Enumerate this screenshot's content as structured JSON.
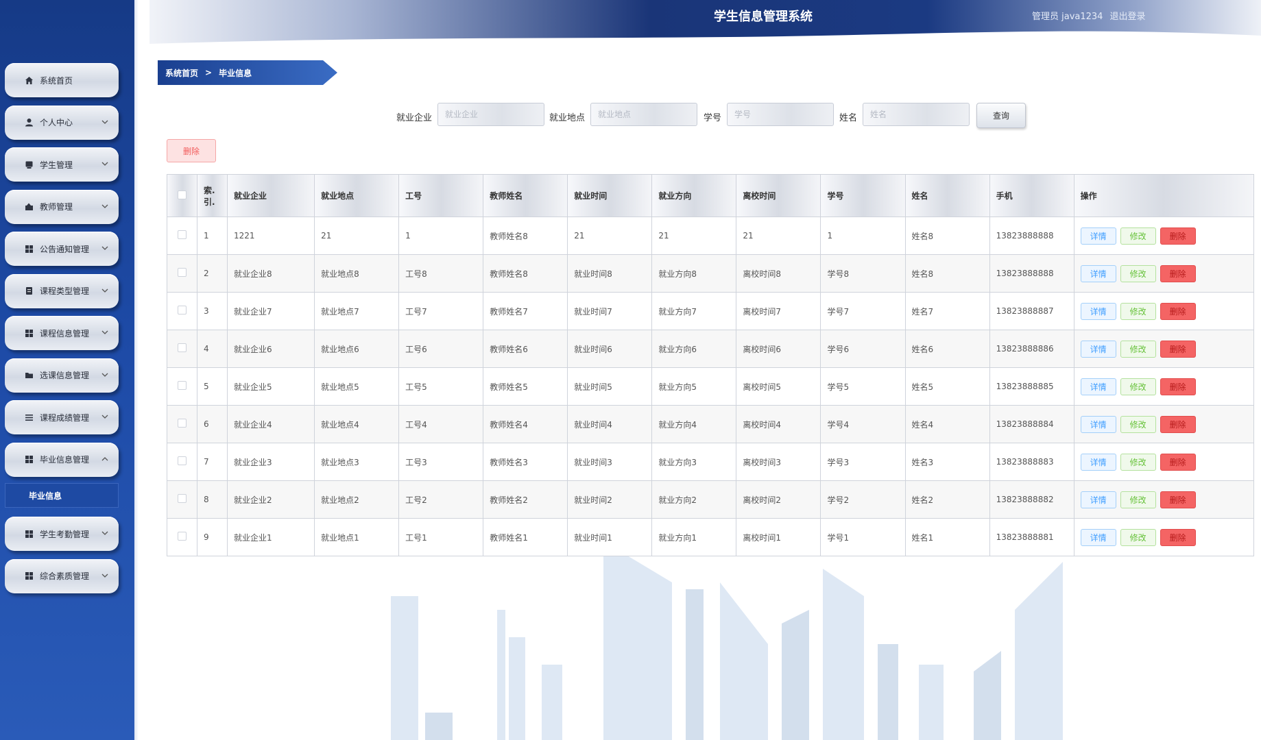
{
  "header": {
    "title": "学生信息管理系统",
    "user": "管理员 java1234",
    "logout": "退出登录"
  },
  "sidebar": {
    "items": [
      {
        "label": "系统首页",
        "icon": "home-icon"
      },
      {
        "label": "个人中心",
        "icon": "user-icon",
        "chevron": "down"
      },
      {
        "label": "学生管理",
        "icon": "card-icon",
        "chevron": "down"
      },
      {
        "label": "教师管理",
        "icon": "teacher-icon",
        "chevron": "down"
      },
      {
        "label": "公告通知管理",
        "icon": "grid-icon",
        "chevron": "down"
      },
      {
        "label": "课程类型管理",
        "icon": "doc-icon",
        "chevron": "down"
      },
      {
        "label": "课程信息管理",
        "icon": "grid-icon",
        "chevron": "down"
      },
      {
        "label": "选课信息管理",
        "icon": "folder-icon",
        "chevron": "down"
      },
      {
        "label": "课程成绩管理",
        "icon": "list-icon",
        "chevron": "down"
      },
      {
        "label": "毕业信息管理",
        "icon": "grid-icon",
        "chevron": "up"
      },
      {
        "label": "学生考勤管理",
        "icon": "grid-icon",
        "chevron": "down"
      },
      {
        "label": "综合素质管理",
        "icon": "grid-icon",
        "chevron": "down"
      }
    ],
    "submenu": {
      "label": "毕业信息"
    }
  },
  "breadcrumb": {
    "home": "系统首页",
    "separator": ">",
    "current": "毕业信息"
  },
  "search": {
    "fields": [
      {
        "label": "就业企业",
        "placeholder": "就业企业"
      },
      {
        "label": "就业地点",
        "placeholder": "就业地点"
      },
      {
        "label": "学号",
        "placeholder": "学号"
      },
      {
        "label": "姓名",
        "placeholder": "姓名"
      }
    ],
    "query_label": "查询"
  },
  "batch_delete_label": "删除",
  "table": {
    "headers": [
      "索引",
      "就业企业",
      "就业地点",
      "工号",
      "教师姓名",
      "就业时间",
      "就业方向",
      "离校时间",
      "学号",
      "姓名",
      "手机",
      "操作"
    ],
    "header_index_parts": [
      "索.",
      "引."
    ],
    "actions": {
      "detail": "详情",
      "edit": "修改",
      "delete": "删除"
    },
    "rows": [
      [
        "1",
        "1221",
        "21",
        "1",
        "教师姓名8",
        "21",
        "21",
        "21",
        "1",
        "姓名8",
        "13823888888"
      ],
      [
        "2",
        "就业企业8",
        "就业地点8",
        "工号8",
        "教师姓名8",
        "就业时间8",
        "就业方向8",
        "离校时间8",
        "学号8",
        "姓名8",
        "13823888888"
      ],
      [
        "3",
        "就业企业7",
        "就业地点7",
        "工号7",
        "教师姓名7",
        "就业时间7",
        "就业方向7",
        "离校时间7",
        "学号7",
        "姓名7",
        "13823888887"
      ],
      [
        "4",
        "就业企业6",
        "就业地点6",
        "工号6",
        "教师姓名6",
        "就业时间6",
        "就业方向6",
        "离校时间6",
        "学号6",
        "姓名6",
        "13823888886"
      ],
      [
        "5",
        "就业企业5",
        "就业地点5",
        "工号5",
        "教师姓名5",
        "就业时间5",
        "就业方向5",
        "离校时间5",
        "学号5",
        "姓名5",
        "13823888885"
      ],
      [
        "6",
        "就业企业4",
        "就业地点4",
        "工号4",
        "教师姓名4",
        "就业时间4",
        "就业方向4",
        "离校时间4",
        "学号4",
        "姓名4",
        "13823888884"
      ],
      [
        "7",
        "就业企业3",
        "就业地点3",
        "工号3",
        "教师姓名3",
        "就业时间3",
        "就业方向3",
        "离校时间3",
        "学号3",
        "姓名3",
        "13823888883"
      ],
      [
        "8",
        "就业企业2",
        "就业地点2",
        "工号2",
        "教师姓名2",
        "就业时间2",
        "就业方向2",
        "离校时间2",
        "学号2",
        "姓名2",
        "13823888882"
      ],
      [
        "9",
        "就业企业1",
        "就业地点1",
        "工号1",
        "教师姓名1",
        "就业时间1",
        "就业方向1",
        "离校时间1",
        "学号1",
        "姓名1",
        "13823888881"
      ]
    ]
  },
  "colors": {
    "sidebar": "#1d4aa6",
    "header": "#1a3578",
    "detail": "#409eff",
    "edit": "#67c23a",
    "delete": "#f46464"
  }
}
